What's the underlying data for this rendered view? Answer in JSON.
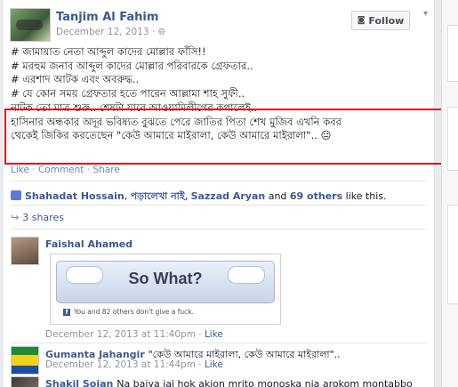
{
  "post": {
    "author": "Tanjim Al Fahim",
    "date": "December 12, 2013",
    "privacy_icon": "globe-icon",
    "follow_label": "Follow",
    "lines": [
      "# জামায়াত নেতা আব্দুল কাদের মোল্লার ফাঁসি!!",
      "# মরহুম জনাব আব্দুল কাদের মোল্লার পরিবারকে গ্রেফতার..",
      "# এরশাদ আটক এবং অবরুদ্ধ..",
      "# যে কোন সময় গ্রেফতার হতে পারেন আল্লামা শাহ সুফী..",
      "নাটক তো মাত্র শুরু.. শেষটা যাবে আওয়ামিলীগের কপালেই..",
      "হাসিনার অন্ধকার অদূর ভবিষ্যত বুঝতে পেরে জাতির পিতা শেখ মুজিব এখনি কবর",
      "থেকেই জিকির করতেছেন \"কেউ আমারে মাইরালা, কেউ আমারে মাইরালা\".. 😐"
    ],
    "actions": [
      "Like",
      "Comment",
      "Share"
    ],
    "likes": {
      "name1": "Shahadat Hossain",
      "name2": "পড়ালেখা নাই",
      "name3": "Sazzad Aryan",
      "and_text": " and ",
      "others": "69 others",
      "suffix": " like this."
    },
    "shares": "3 shares"
  },
  "comments": [
    {
      "author": "Faishal Ahamed",
      "text": "",
      "attachment": {
        "button_text": "So What?",
        "footer": "You and 82 others don't give a fuck."
      },
      "time": "December 12, 2013 at 11:40pm",
      "like": "Like"
    },
    {
      "author": "Gumanta Jahangir",
      "text": "\"কেউ আমারে মাইরালা, কেউ আমারে মাইরালা\"..",
      "time": "December 12, 2013 at 11:44pm",
      "like": "Like"
    },
    {
      "author": "Shakil Sojan",
      "text": "Na baiya jai hok akjon mrito monoska nia arokom montabbo"
    }
  ],
  "colors": {
    "link": "#3b5998",
    "highlight_border": "#e0131e"
  }
}
